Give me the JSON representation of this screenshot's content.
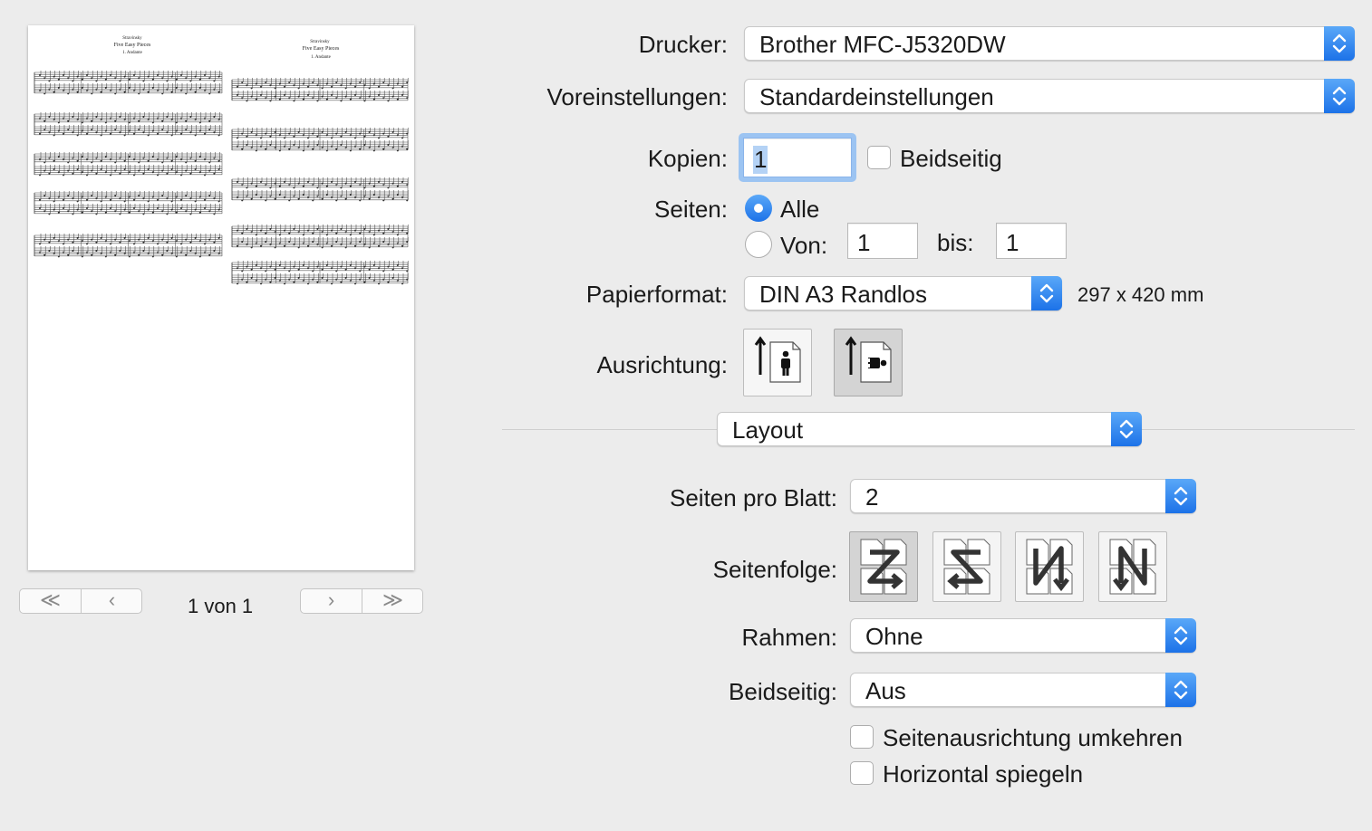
{
  "printer": {
    "label": "Drucker:",
    "value": "Brother MFC-J5320DW"
  },
  "presets": {
    "label": "Voreinstellungen:",
    "value": "Standardeinstellungen"
  },
  "copies": {
    "label": "Kopien:",
    "value": "1",
    "duplex_label": "Beidseitig"
  },
  "pages": {
    "label": "Seiten:",
    "all_label": "Alle",
    "from_label": "Von:",
    "from_value": "1",
    "to_label": "bis:",
    "to_value": "1"
  },
  "paper": {
    "label": "Papierformat:",
    "value": "DIN A3 Randlos",
    "size": "297 x 420 mm"
  },
  "orientation": {
    "label": "Ausrichtung:"
  },
  "section": {
    "value": "Layout"
  },
  "layout": {
    "pages_per_sheet": {
      "label": "Seiten pro Blatt:",
      "value": "2"
    },
    "page_order": {
      "label": "Seitenfolge:"
    },
    "border": {
      "label": "Rahmen:",
      "value": "Ohne"
    },
    "two_sided": {
      "label": "Beidseitig:",
      "value": "Aus"
    },
    "reverse_label": "Seitenausrichtung umkehren",
    "flip_label": "Horizontal spiegeln"
  },
  "preview": {
    "page_indicator": "1 von 1",
    "left": {
      "composer": "Stravinsky",
      "title": "Five Easy Pieces",
      "movement": "1. Andante"
    },
    "right": {
      "composer": "Stravinsky",
      "title": "Five Easy Pieces",
      "movement": "1. Andante"
    }
  },
  "colors": {
    "accent": "#1c72e8",
    "window_bg": "#ececec"
  }
}
